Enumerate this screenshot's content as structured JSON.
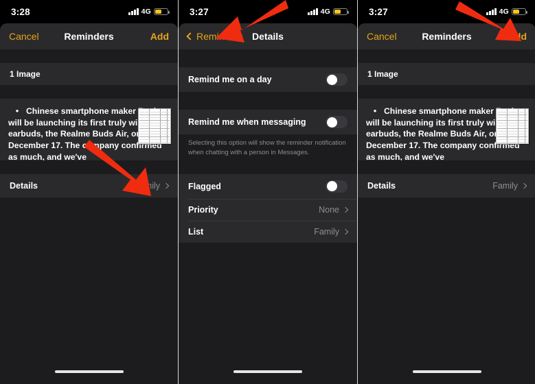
{
  "meta": {
    "accent_yellow": "#e8a317",
    "arrow_red": "#f02c10",
    "bg_black": "#000000",
    "group_bg": "#2a2a2c",
    "sheet_bg": "#1c1c1e",
    "secondary_text": "#8e8e93"
  },
  "panels": [
    {
      "id": "panel-1",
      "statusbar": {
        "time": "3:28",
        "network": "4G",
        "signal_icon": "cellular-signal-icon",
        "battery_icon": "battery-icon"
      },
      "navbar": {
        "left_label": "Cancel",
        "title": "Reminders",
        "right_label": "Add",
        "has_back_chevron": false
      },
      "image_row": {
        "label": "1 Image"
      },
      "note": {
        "bullet": "•",
        "text": "Chinese smartphone maker Realme will be launching its first truly wireless earbuds, the Realme Buds Air, on December 17. The company confirmed as much, and we've",
        "thumbnail_name": "spreadsheet-thumbnail"
      },
      "details_row": {
        "label": "Details",
        "value": "Family",
        "chevron": "chevron-right-icon"
      }
    },
    {
      "id": "panel-2",
      "statusbar": {
        "time": "3:27",
        "network": "4G",
        "signal_icon": "cellular-signal-icon",
        "battery_icon": "battery-icon"
      },
      "navbar": {
        "left_label": "Reminders",
        "title": "Details",
        "right_label": "",
        "has_back_chevron": true
      },
      "rows": [
        {
          "label": "Remind me on a day",
          "control": "toggle",
          "state": "off"
        },
        {
          "label": "Remind me when messaging",
          "control": "toggle",
          "state": "off"
        }
      ],
      "footnote": "Selecting this option will show the reminder notification when chatting with a person in Messages.",
      "rows2": [
        {
          "label": "Flagged",
          "control": "toggle",
          "state": "off"
        },
        {
          "label": "Priority",
          "control": "value",
          "value": "None"
        },
        {
          "label": "List",
          "control": "value",
          "value": "Family"
        }
      ]
    },
    {
      "id": "panel-3",
      "statusbar": {
        "time": "3:27",
        "network": "4G",
        "signal_icon": "cellular-signal-icon",
        "battery_icon": "battery-icon"
      },
      "navbar": {
        "left_label": "Cancel",
        "title": "Reminders",
        "right_label": "Add",
        "has_back_chevron": false
      },
      "image_row": {
        "label": "1 Image"
      },
      "note": {
        "bullet": "•",
        "text": "Chinese smartphone maker Realme will be launching its first truly wireless earbuds, the Realme Buds Air, on December 17. The company confirmed as much, and we've",
        "thumbnail_name": "spreadsheet-thumbnail"
      },
      "details_row": {
        "label": "Details",
        "value": "Family",
        "chevron": "chevron-right-icon"
      }
    }
  ],
  "annotations": [
    {
      "name": "arrow-to-family",
      "points_to": "Family",
      "panel": 1
    },
    {
      "name": "arrow-to-reminders-back",
      "points_to": "Reminders",
      "panel": 2
    },
    {
      "name": "arrow-to-add",
      "points_to": "Add",
      "panel": 3
    }
  ]
}
